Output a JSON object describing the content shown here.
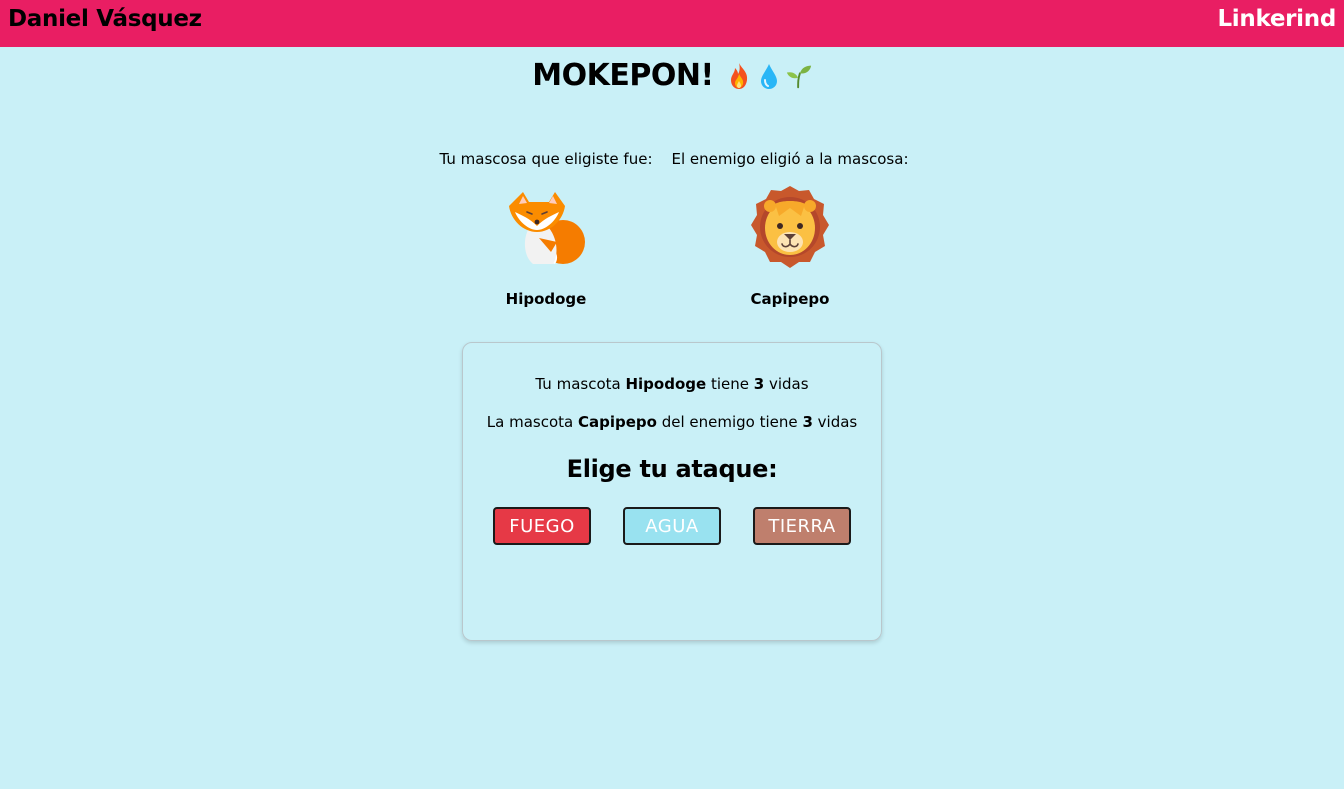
{
  "header": {
    "author": "Daniel Vásquez",
    "brand": "Linkerind",
    "background_color": "#e91e63"
  },
  "game": {
    "title": "MOKEPON!",
    "title_icons": [
      "fire-icon",
      "water-drop-icon",
      "seedling-icon"
    ]
  },
  "player": {
    "caption": "Tu mascosa que eligiste fue:",
    "pet_name": "Hipodoge",
    "pet_icon": "fox-icon"
  },
  "enemy": {
    "caption": "El enemigo eligió a la mascosa:",
    "pet_name": "Capipepo",
    "pet_icon": "lion-icon"
  },
  "status": {
    "player_prefix": "Tu mascota",
    "player_pet": "Hipodoge",
    "player_mid": "tiene",
    "player_lives": "3",
    "player_suffix": "vidas",
    "enemy_prefix": "La mascota",
    "enemy_pet": "Capipepo",
    "enemy_mid": "del enemigo tiene",
    "enemy_lives": "3",
    "enemy_suffix": "vidas"
  },
  "attack": {
    "heading": "Elige tu ataque:",
    "buttons": [
      {
        "label": "FUEGO",
        "color": "#e63946"
      },
      {
        "label": "AGUA",
        "color": "#99e2f0"
      },
      {
        "label": "TIERRA",
        "color": "#bf7f6d"
      }
    ]
  },
  "colors": {
    "page_background": "#c9f0f7"
  }
}
